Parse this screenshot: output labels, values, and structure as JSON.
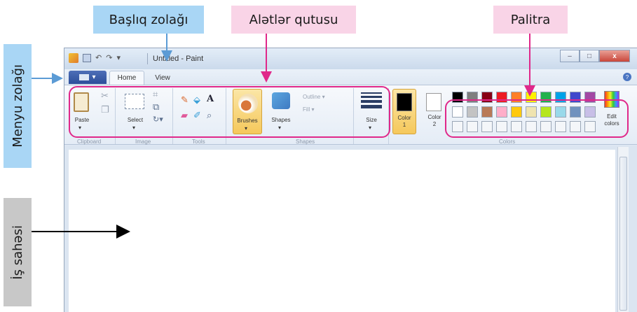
{
  "callouts": {
    "title_bar": "Başlıq zolağı",
    "toolbox": "Alətlər qutusu",
    "palette": "Palitra",
    "menu_bar": "Menyu zolağı",
    "work_area": "İş sahəsi"
  },
  "window": {
    "title": "Untitled - Paint",
    "controls": {
      "minimize": "–",
      "maximize": "□",
      "close": "x"
    }
  },
  "menu": {
    "file_icon": "paint-menu-icon",
    "tabs": [
      "Home",
      "View"
    ]
  },
  "ribbon": {
    "groups": [
      "Clipboard",
      "Image",
      "Tools",
      "Shapes",
      "Colors"
    ],
    "paste": "Paste",
    "select": "Select",
    "brushes": "Brushes",
    "shapes": "Shapes",
    "outline": "Outline",
    "fill": "Fill",
    "size": "Size",
    "color1": [
      "Color",
      "1"
    ],
    "color2": [
      "Color",
      "2"
    ],
    "edit_colors": [
      "Edit",
      "colors"
    ]
  },
  "palette_colors": [
    "#000000",
    "#7f7f7f",
    "#880015",
    "#ed1c24",
    "#ff7f27",
    "#fff200",
    "#22b14c",
    "#00a2e8",
    "#3f48cc",
    "#a349a4",
    "#ffffff",
    "#c3c3c3",
    "#b97a57",
    "#ffaec9",
    "#ffc90e",
    "#efe4b0",
    "#b5e61d",
    "#99d9ea",
    "#7092be",
    "#c8bfe7",
    "#f4f6f9",
    "#f4f6f9",
    "#f4f6f9",
    "#f4f6f9",
    "#f4f6f9",
    "#f4f6f9",
    "#f4f6f9",
    "#f4f6f9",
    "#f4f6f9",
    "#f4f6f9"
  ],
  "colors": {
    "highlight": "#e0288a",
    "arrow_blue": "#5b9bd5",
    "callout_blue": "#a9d6f5",
    "callout_pink": "#f9d4e7",
    "callout_gray": "#c8c8c8"
  }
}
